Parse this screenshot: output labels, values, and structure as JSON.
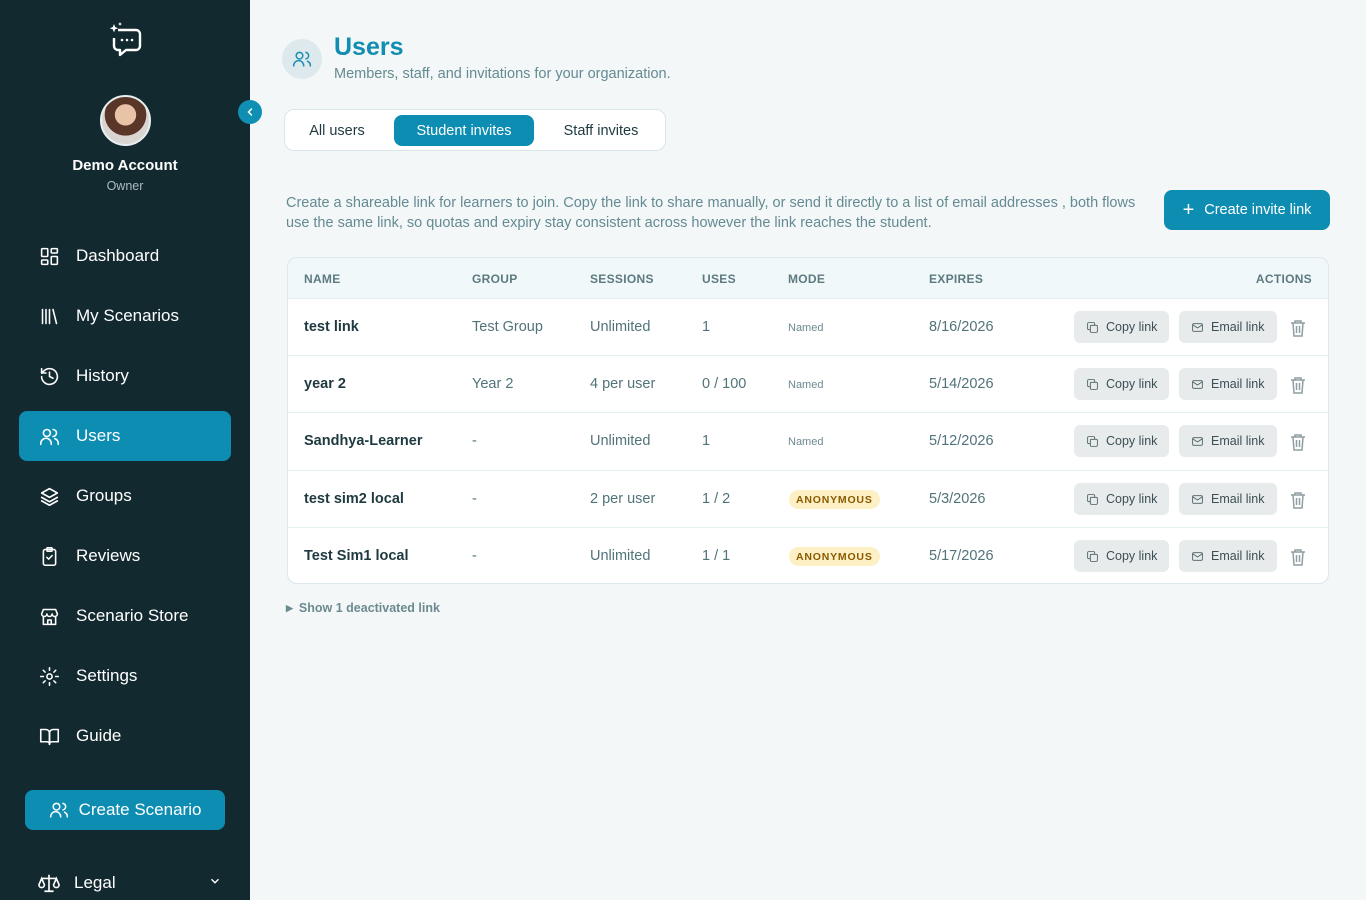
{
  "sidebar": {
    "account": {
      "name": "Demo Account",
      "role": "Owner"
    },
    "items": [
      {
        "label": "Dashboard",
        "icon": "dashboard-icon"
      },
      {
        "label": "My Scenarios",
        "icon": "library-icon"
      },
      {
        "label": "History",
        "icon": "history-icon"
      },
      {
        "label": "Users",
        "icon": "users-icon",
        "active": true
      },
      {
        "label": "Groups",
        "icon": "layers-icon"
      },
      {
        "label": "Reviews",
        "icon": "clipboard-icon"
      },
      {
        "label": "Scenario Store",
        "icon": "store-icon"
      },
      {
        "label": "Settings",
        "icon": "gear-icon"
      },
      {
        "label": "Guide",
        "icon": "book-icon"
      }
    ],
    "create_scenario": "Create Scenario",
    "legal": "Legal"
  },
  "header": {
    "title": "Users",
    "subtitle": "Members, staff, and invitations for your organization."
  },
  "tabs": [
    "All users",
    "Student invites",
    "Staff invites"
  ],
  "active_tab": "Student invites",
  "description": "Create a shareable link for learners to join. Copy the link to share manually, or send it directly to a list of email addresses , both flows use the same link, so quotas and expiry stay consistent across however the link reaches the student.",
  "create_invite_label": "Create invite link",
  "table": {
    "headers": {
      "name": "NAME",
      "group": "GROUP",
      "sessions": "SESSIONS",
      "uses": "USES",
      "mode": "MODE",
      "expires": "EXPIRES",
      "actions": "ACTIONS"
    },
    "copy_label": "Copy link",
    "email_label": "Email link",
    "rows": [
      {
        "name": "test link",
        "group": "Test Group",
        "sessions": "Unlimited",
        "uses": "1",
        "mode": "Named",
        "expires": "8/16/2026"
      },
      {
        "name": "year 2",
        "group": "Year 2",
        "sessions": "4 per user",
        "uses": "0 / 100",
        "mode": "Named",
        "expires": "5/14/2026"
      },
      {
        "name": "Sandhya-Learner",
        "group": "-",
        "sessions": "Unlimited",
        "uses": "1",
        "mode": "Named",
        "expires": "5/12/2026"
      },
      {
        "name": "test sim2 local",
        "group": "-",
        "sessions": "2 per user",
        "uses": "1 / 2",
        "mode": "ANONYMOUS",
        "expires": "5/3/2026"
      },
      {
        "name": "Test Sim1 local",
        "group": "-",
        "sessions": "Unlimited",
        "uses": "1 / 1",
        "mode": "ANONYMOUS",
        "expires": "5/17/2026"
      }
    ]
  },
  "deactivated_label": "Show 1 deactivated link",
  "colors": {
    "accent": "#0e8db3",
    "sidebar": "#12292f",
    "badge_bg": "#fdf0c4"
  }
}
